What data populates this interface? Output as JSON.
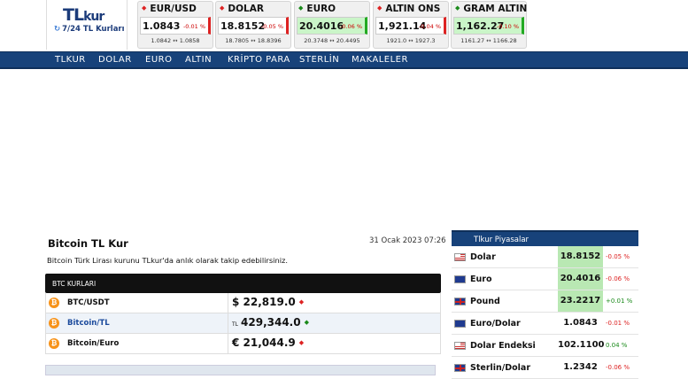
{
  "logo": {
    "brand_main": "TL",
    "brand_kur": "kur",
    "tagline": "7/24 TL Kurları",
    "tagline_icon": "refresh-icon"
  },
  "tickers": [
    {
      "name": "EUR/USD",
      "value": "1.0843",
      "change": "-0.01 %",
      "low": "1.0842",
      "high": "1.0858",
      "direction": "down"
    },
    {
      "name": "DOLAR",
      "value": "18.8152",
      "change": "-0.05 %",
      "low": "18.7805",
      "high": "18.8396",
      "direction": "down"
    },
    {
      "name": "EURO",
      "value": "20.4016",
      "change": "-0.06 %",
      "low": "20.3748",
      "high": "20.4495",
      "direction": "down"
    },
    {
      "name": "ALTIN ONS",
      "value": "1,921.14",
      "change": "-0.04 %",
      "low": "1921.0",
      "high": "1927.3",
      "direction": "down"
    },
    {
      "name": "GRAM ALTIN",
      "value": "1,162.27",
      "change": "-0.10 %",
      "low": "1161.27",
      "high": "1166.28",
      "direction": "up"
    }
  ],
  "range_arrow": "↔",
  "nav": [
    "TLKUR",
    "DOLAR",
    "EURO",
    "ALTIN",
    "KRİPTO PARA",
    "STERLİN",
    "MAKALELER"
  ],
  "page": {
    "title": "Bitcoin TL Kur",
    "date": "31 Ocak 2023 07:26",
    "description": "Bitcoin Türk Lirası kurunu TLkur'da anlık olarak takip edebilirsiniz.",
    "table_header": "BTC KURLARI",
    "rows": [
      {
        "name": "BTC/USDT",
        "currency": "$",
        "value": "22,819.0",
        "arrow": "◆"
      },
      {
        "name": "Bitcoin/TL",
        "currency": "TL",
        "value": "429,344.0",
        "arrow": "◆"
      },
      {
        "name": "Bitcoin/Euro",
        "currency": "€",
        "value": "21,044.9",
        "arrow": "◆"
      }
    ]
  },
  "sidebar": {
    "title": "Tlkur Piyasalar",
    "items": [
      {
        "name": "Dolar",
        "value": "18.8152",
        "change": "-0.05 %",
        "flag": "us-flag-icon"
      },
      {
        "name": "Euro",
        "value": "20.4016",
        "change": "-0.06 %",
        "flag": "eu-flag-icon"
      },
      {
        "name": "Pound",
        "value": "23.2217",
        "change": "+0.01 %",
        "flag": "uk-flag-icon"
      },
      {
        "name": "Euro/Dolar",
        "value": "1.0843",
        "change": "-0.01 %",
        "flag": "eu-flag-icon"
      },
      {
        "name": "Dolar Endeksi",
        "value": "102.1100",
        "change": "0.04 %",
        "flag": "us-flag-icon"
      },
      {
        "name": "Sterlin/Dolar",
        "value": "1.2342",
        "change": "-0.06 %",
        "flag": "uk-flag-icon"
      }
    ]
  },
  "colors": {
    "navy": "#17427a",
    "up": "#1a8a1a",
    "down": "#d22222",
    "green_cell": "#b9e8b3"
  }
}
